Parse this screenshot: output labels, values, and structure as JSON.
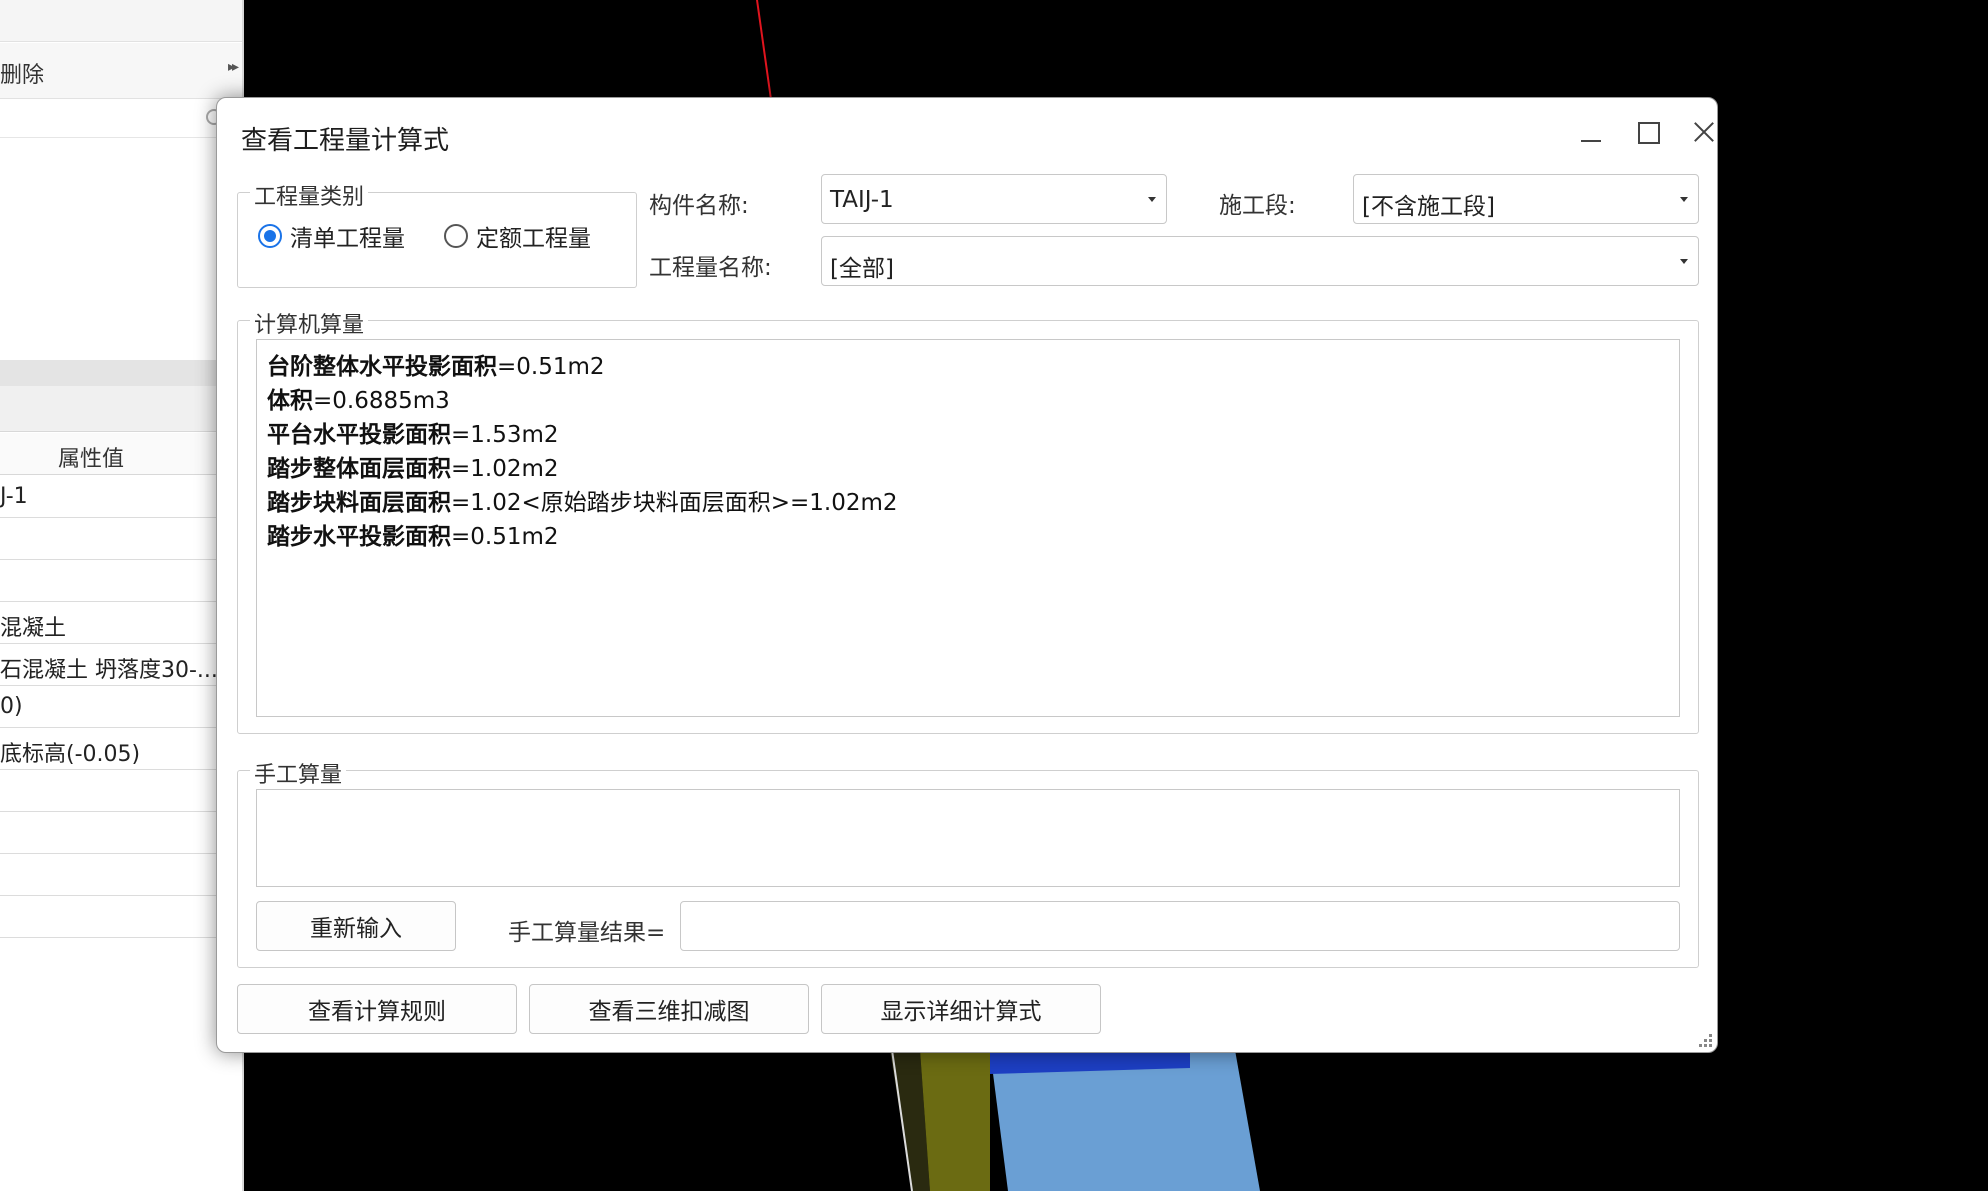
{
  "left_panel": {
    "delete_label": "删除",
    "more_icon": "double-chevron-right-icon",
    "property_header": "属性值",
    "rows": [
      "J-1",
      "",
      "",
      "混凝土",
      "石混凝土 坍落度30-...",
      "0)",
      "底标高(-0.05)",
      "",
      "",
      "",
      ""
    ]
  },
  "dialog": {
    "title": "查看工程量计算式",
    "window_controls": [
      "minimize-icon",
      "maximize-icon",
      "close-icon"
    ],
    "quantity_type": {
      "legend": "工程量类别",
      "options": [
        {
          "label": "清单工程量",
          "selected": true
        },
        {
          "label": "定额工程量",
          "selected": false
        }
      ]
    },
    "component_name": {
      "label": "构件名称:",
      "value": "TAIJ-1"
    },
    "construction_stage": {
      "label": "施工段:",
      "value": "[不含施工段]"
    },
    "quantity_name": {
      "label": "工程量名称:",
      "value": "[全部]"
    },
    "computer_calc": {
      "legend": "计算机算量",
      "lines": [
        {
          "name": "台阶整体水平投影面积",
          "expr": "=0.51m2"
        },
        {
          "name": "体积",
          "expr": "=0.6885m3"
        },
        {
          "name": "平台水平投影面积",
          "expr": "=1.53m2"
        },
        {
          "name": "踏步整体面层面积",
          "expr": "=1.02m2"
        },
        {
          "name": "踏步块料面层面积",
          "expr": "=1.02<原始踏步块料面层面积>=1.02m2"
        },
        {
          "name": "踏步水平投影面积",
          "expr": "=0.51m2"
        }
      ]
    },
    "manual_calc": {
      "legend": "手工算量",
      "reenter_button": "重新输入",
      "result_label": "手工算量结果=",
      "result_value": ""
    },
    "buttons": {
      "view_rules": "查看计算规则",
      "view_3d": "查看三维扣减图",
      "show_detail": "显示详细计算式"
    }
  },
  "colors": {
    "radio_selected": "#1a73e8",
    "viewport_bg": "#000000",
    "red_axis": "#e0141e"
  }
}
